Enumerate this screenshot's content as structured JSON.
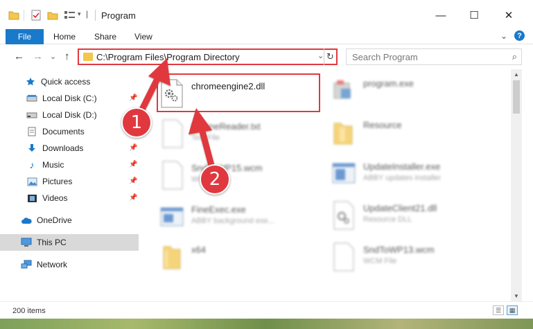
{
  "window": {
    "title": "Program",
    "minimize": "—",
    "maximize": "☐",
    "close": "✕"
  },
  "ribbon": {
    "file_tab": "File",
    "tabs": [
      "Home",
      "Share",
      "View"
    ],
    "expand": "⌄",
    "help": "?"
  },
  "nav": {
    "back": "←",
    "forward": "→",
    "recent": "⌄",
    "up": "↑",
    "address": "C:\\Program Files\\Program Directory",
    "address_dropdown": "⌄",
    "refresh": "↻",
    "search_placeholder": "Search Program",
    "search_icon": "⌕"
  },
  "sidebar": {
    "items": [
      {
        "label": "Quick access",
        "icon": "star-icon"
      },
      {
        "label": "Local Disk (C:)",
        "icon": "drive-icon",
        "pinned": true
      },
      {
        "label": "Local Disk (D:)",
        "icon": "drive-icon"
      },
      {
        "label": "Documents",
        "icon": "documents-icon",
        "pinned": true
      },
      {
        "label": "Downloads",
        "icon": "download-icon",
        "pinned": true
      },
      {
        "label": "Music",
        "icon": "music-icon",
        "pinned": true
      },
      {
        "label": "Pictures",
        "icon": "pictures-icon",
        "pinned": true
      },
      {
        "label": "Videos",
        "icon": "videos-icon",
        "pinned": true
      },
      {
        "label": "OneDrive",
        "icon": "cloud-icon"
      },
      {
        "label": "This PC",
        "icon": "computer-icon",
        "selected": true
      },
      {
        "label": "Network",
        "icon": "network-icon"
      }
    ]
  },
  "files": {
    "left": [
      {
        "name": "chromeengine2.dll",
        "sub": ""
      },
      {
        "name": "EngineReader.txt",
        "sub": "Text File"
      },
      {
        "name": "SndToWP15.wcm",
        "sub": "WCM File"
      },
      {
        "name": "FineExec.exe",
        "sub": "ABBY background exe..."
      },
      {
        "name": "x64",
        "sub": ""
      }
    ],
    "right": [
      {
        "name": "program.exe",
        "sub": ""
      },
      {
        "name": "Resource",
        "sub": ""
      },
      {
        "name": "UpdateInstaller.exe",
        "sub": "ABBY updates installer"
      },
      {
        "name": "UpdateClient21.dll",
        "sub": "Resource DLL"
      },
      {
        "name": "SndToWP13.wcm",
        "sub": "WCM File"
      }
    ]
  },
  "status": {
    "count": "200 items"
  },
  "callouts": {
    "one": "1",
    "two": "2"
  },
  "colors": {
    "accent": "#1979ca",
    "highlight": "#e0383e",
    "folder": "#f4c64e"
  }
}
